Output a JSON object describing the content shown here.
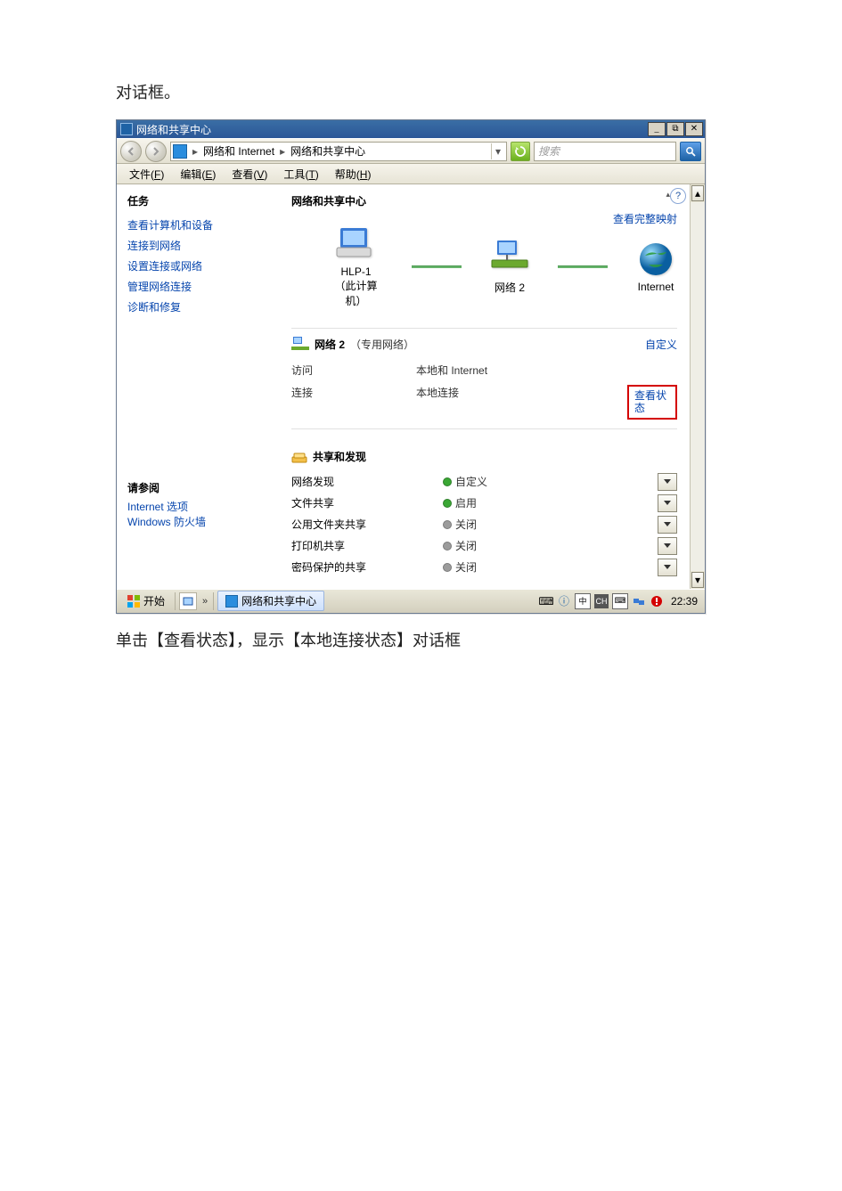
{
  "doc": {
    "above": "对话框。",
    "below": "单击【查看状态】，显示【本地连接状态】对话框"
  },
  "titlebar": {
    "title": "网络和共享中心",
    "min_tooltip": "最小化",
    "restore_tooltip": "还原",
    "close_tooltip": "关闭"
  },
  "toolbar": {
    "path_seg1": "网络和 Internet",
    "path_seg2": "网络和共享中心",
    "search_placeholder": "搜索"
  },
  "menubar": {
    "file": "文件",
    "file_key": "F",
    "edit": "编辑",
    "edit_key": "E",
    "view": "查看",
    "view_key": "V",
    "tools": "工具",
    "tools_key": "T",
    "help": "帮助",
    "help_key": "H"
  },
  "sidebar": {
    "tasks_head": "任务",
    "items": [
      "查看计算机和设备",
      "连接到网络",
      "设置连接或网络",
      "管理网络连接",
      "诊断和修复"
    ],
    "see_also_head": "请参阅",
    "see_also": [
      "Internet 选项",
      "Windows 防火墙"
    ]
  },
  "main": {
    "title": "网络和共享中心",
    "view_full_map": "查看完整映射",
    "map": {
      "node1": "HLP-1",
      "node1_sub": "（此计算机）",
      "node2": "网络  2",
      "node3": "Internet"
    },
    "network_section": {
      "name": "网络  2",
      "type": "（专用网络）",
      "customize": "自定义",
      "rows": {
        "access_label": "访问",
        "access_value": "本地和 Internet",
        "connection_label": "连接",
        "connection_value": "本地连接",
        "view_status": "查看状态"
      }
    },
    "sharing_section": {
      "title": "共享和发现",
      "rows": [
        {
          "label": "网络发现",
          "status": "自定义",
          "on": true
        },
        {
          "label": "文件共享",
          "status": "启用",
          "on": true
        },
        {
          "label": "公用文件夹共享",
          "status": "关闭",
          "on": false
        },
        {
          "label": "打印机共享",
          "status": "关闭",
          "on": false
        },
        {
          "label": "密码保护的共享",
          "status": "关闭",
          "on": false
        }
      ]
    }
  },
  "taskbar": {
    "start": "开始",
    "task_name": "网络和共享中心",
    "clock": "22:39"
  }
}
